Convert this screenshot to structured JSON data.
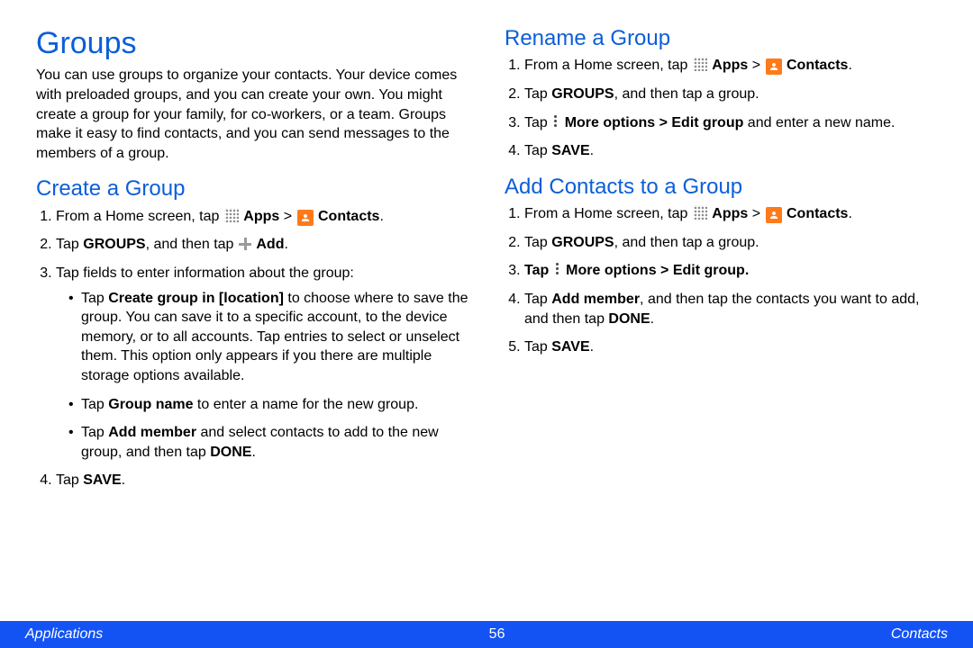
{
  "left": {
    "title": "Groups",
    "intro": "You can use groups to organize your contacts. Your device comes with preloaded groups, and you can create your own. You might create a group for your family, for co-workers, or a team. Groups make it easy to find contacts, and you can send messages to the members of a group.",
    "createTitle": "Create a Group",
    "step1_a": "From a Home screen, tap ",
    "step1_apps": "Apps",
    "step1_sep": " > ",
    "step1_contacts": "Contacts",
    "step1_end": ".",
    "step2_a": "Tap ",
    "step2_b": "GROUPS",
    "step2_c": ", and then tap ",
    "step2_add": "Add",
    "step2_end": ".",
    "step3": "Tap fields to enter information about the group:",
    "sub1_a": "Tap ",
    "sub1_b": "Create group in [location]",
    "sub1_c": " to choose where to save the group. You can save it to a specific account, to the device memory, or to all accounts. Tap entries to select or unselect them. This option only appears if you there are multiple storage options available.",
    "sub2_a": "Tap ",
    "sub2_b": "Group name",
    "sub2_c": " to enter a name for the new group.",
    "sub3_a": "Tap ",
    "sub3_b": "Add member",
    "sub3_c": " and select contacts to add to the new group, and then tap ",
    "sub3_d": "DONE",
    "sub3_e": ".",
    "step4_a": "Tap ",
    "step4_b": "SAVE",
    "step4_c": "."
  },
  "right": {
    "renameTitle": "Rename a Group",
    "r1_a": "From a Home screen, tap ",
    "apps": "Apps",
    "sep": " > ",
    "contacts": "Contacts",
    "dot": ".",
    "r2_a": "Tap ",
    "r2_b": "GROUPS",
    "r2_c": ", and then tap a group.",
    "r3_a": "Tap ",
    "r3_b": "More options > Edit group",
    "r3_c": " and enter a new name.",
    "r4_a": "Tap ",
    "r4_b": "SAVE",
    "r4_c": ".",
    "addTitle": "Add Contacts to a Group",
    "a3_a": "Tap ",
    "a3_b": "More options > Edit group",
    "a3_c": ".",
    "a4_a": "Tap ",
    "a4_b": "Add member",
    "a4_c": ", and then tap the contacts you want to add, and then tap ",
    "a4_d": "DONE",
    "a4_e": ".",
    "a5_a": "Tap ",
    "a5_b": "SAVE",
    "a5_c": "."
  },
  "footer": {
    "left": "Applications",
    "center": "56",
    "right": "Contacts"
  }
}
